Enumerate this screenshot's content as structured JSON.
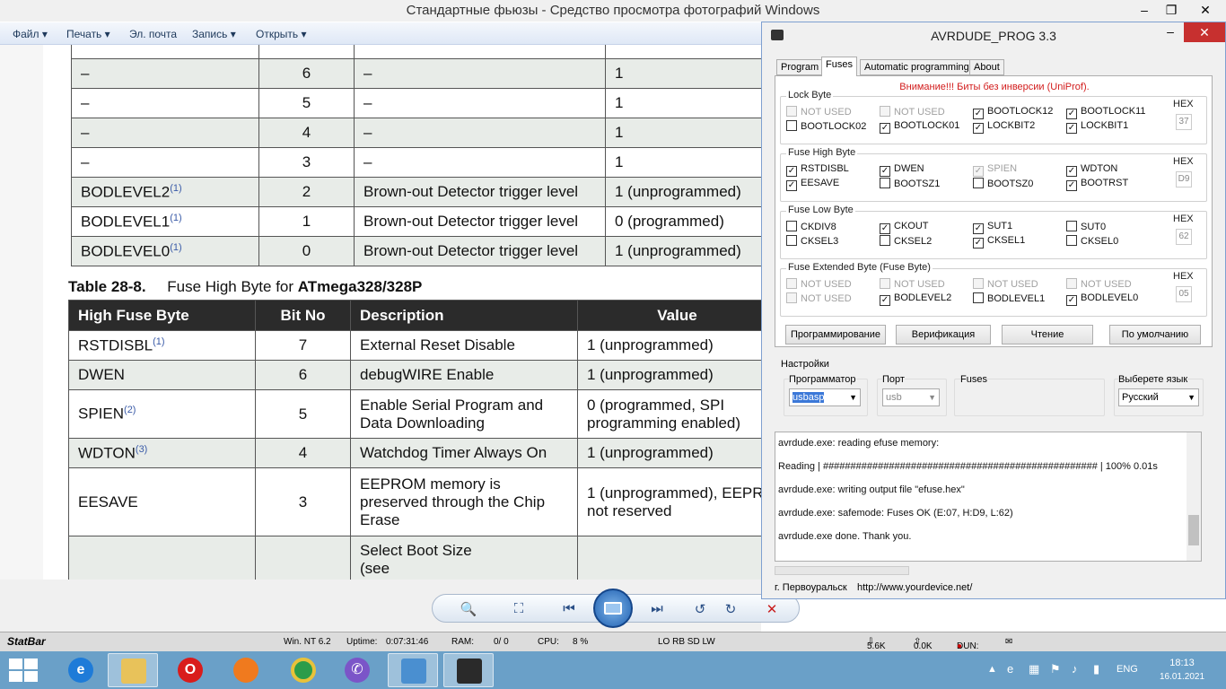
{
  "viewer": {
    "title": "Стандартные фьюзы - Средство просмотра фотографий Windows",
    "menu": [
      "Файл",
      "Печать",
      "Эл. почта",
      "Запись",
      "Открыть"
    ]
  },
  "doc": {
    "top_rows": [
      {
        "name": "–",
        "bit": "6",
        "desc": "–",
        "val": "1"
      },
      {
        "name": "–",
        "bit": "5",
        "desc": "–",
        "val": "1"
      },
      {
        "name": "–",
        "bit": "4",
        "desc": "–",
        "val": "1"
      },
      {
        "name": "–",
        "bit": "3",
        "desc": "–",
        "val": "1"
      },
      {
        "name": "BODLEVEL2",
        "sup": "(1)",
        "bit": "2",
        "desc": "Brown-out Detector trigger level",
        "val": "1 (unprogrammed)"
      },
      {
        "name": "BODLEVEL1",
        "sup": "(1)",
        "bit": "1",
        "desc": "Brown-out Detector trigger level",
        "val": "0 (programmed)"
      },
      {
        "name": "BODLEVEL0",
        "sup": "(1)",
        "bit": "0",
        "desc": "Brown-out Detector trigger level",
        "val": "1 (unprogrammed)"
      }
    ],
    "caption_num": "Table 28-8.",
    "caption_text": "Fuse High Byte for ",
    "caption_bold": "ATmega328/328P",
    "head": [
      "High Fuse Byte",
      "Bit No",
      "Description",
      "Value"
    ],
    "rows": [
      {
        "name": "RSTDISBL",
        "sup": "(1)",
        "bit": "7",
        "desc": "External Reset Disable",
        "val": "1 (unprogrammed)"
      },
      {
        "name": "DWEN",
        "sup": "",
        "bit": "6",
        "desc": "debugWIRE Enable",
        "val": "1 (unprogrammed)"
      },
      {
        "name": "SPIEN",
        "sup": "(2)",
        "bit": "5",
        "desc1": "Enable Serial Program and",
        "desc2": "Data Downloading",
        "val1": "0 (programmed, SPI",
        "val2": "programming enabled)"
      },
      {
        "name": "WDTON",
        "sup": "(3)",
        "bit": "4",
        "desc": "Watchdog Timer Always On",
        "val": "1 (unprogrammed)"
      },
      {
        "name": "EESAVE",
        "sup": "",
        "bit": "3",
        "desc1": "EEPROM memory is",
        "desc2": "preserved through the Chip",
        "desc3": "Erase",
        "val1": "1 (unprogrammed), EEPR",
        "val2": "not reserved"
      },
      {
        "desc1": "Select Boot Size",
        "desc2": "(see"
      }
    ]
  },
  "avr": {
    "title": "AVRDUDE_PROG 3.3",
    "tabs": [
      "Program",
      "Fuses",
      "Automatic programming",
      "About"
    ],
    "warning": "Внимание!!! Биты без инверсии (UniProf).",
    "lock": {
      "label": "Lock Byte",
      "hex": "37",
      "bits": [
        {
          "t": "NOT USED",
          "c": false,
          "d": true
        },
        {
          "t": "NOT USED",
          "c": false,
          "d": true
        },
        {
          "t": "BOOTLOCK12",
          "c": true,
          "d": false
        },
        {
          "t": "BOOTLOCK11",
          "c": true,
          "d": false
        },
        {
          "t": "BOOTLOCK02",
          "c": false,
          "d": false
        },
        {
          "t": "BOOTLOCK01",
          "c": true,
          "d": false
        },
        {
          "t": "LOCKBIT2",
          "c": true,
          "d": false
        },
        {
          "t": "LOCKBIT1",
          "c": true,
          "d": false
        }
      ]
    },
    "high": {
      "label": "Fuse High Byte",
      "hex": "D9",
      "bits": [
        {
          "t": "RSTDISBL",
          "c": true,
          "d": false
        },
        {
          "t": "DWEN",
          "c": true,
          "d": false
        },
        {
          "t": "SPIEN",
          "c": true,
          "d": true
        },
        {
          "t": "WDTON",
          "c": true,
          "d": false
        },
        {
          "t": "EESAVE",
          "c": true,
          "d": false
        },
        {
          "t": "BOOTSZ1",
          "c": false,
          "d": false
        },
        {
          "t": "BOOTSZ0",
          "c": false,
          "d": false
        },
        {
          "t": "BOOTRST",
          "c": true,
          "d": false
        }
      ]
    },
    "low": {
      "label": "Fuse Low Byte",
      "hex": "62",
      "bits": [
        {
          "t": "CKDIV8",
          "c": false,
          "d": false
        },
        {
          "t": "CKOUT",
          "c": true,
          "d": false
        },
        {
          "t": "SUT1",
          "c": true,
          "d": false
        },
        {
          "t": "SUT0",
          "c": false,
          "d": false
        },
        {
          "t": "CKSEL3",
          "c": false,
          "d": false
        },
        {
          "t": "CKSEL2",
          "c": false,
          "d": false
        },
        {
          "t": "CKSEL1",
          "c": true,
          "d": false
        },
        {
          "t": "CKSEL0",
          "c": false,
          "d": false
        }
      ]
    },
    "ext": {
      "label": "Fuse Extended Byte (Fuse Byte)",
      "hex": "05",
      "bits": [
        {
          "t": "NOT USED",
          "c": false,
          "d": true
        },
        {
          "t": "NOT USED",
          "c": false,
          "d": true
        },
        {
          "t": "NOT USED",
          "c": false,
          "d": true
        },
        {
          "t": "NOT USED",
          "c": false,
          "d": true
        },
        {
          "t": "NOT USED",
          "c": false,
          "d": true
        },
        {
          "t": "BODLEVEL2",
          "c": true,
          "d": false
        },
        {
          "t": "BODLEVEL1",
          "c": false,
          "d": false
        },
        {
          "t": "BODLEVEL0",
          "c": true,
          "d": false
        }
      ]
    },
    "hex_label": "HEX",
    "buttons": [
      "Программирование",
      "Верификация",
      "Чтение",
      "По умолчанию"
    ],
    "settings": {
      "label": "Настройки",
      "programmer_label": "Программатор",
      "programmer": "usbasp",
      "port_label": "Порт",
      "port": "usb",
      "fuses_label": "Fuses",
      "lang_label": "Выберете язык",
      "lang": "Русский"
    },
    "log": [
      "avrdude.exe: reading efuse memory:",
      "Reading | ################################################## | 100% 0.01s",
      "avrdude.exe: writing output file \"efuse.hex\"",
      "avrdude.exe: safemode: Fuses OK (E:07, H:D9, L:62)",
      "avrdude.exe done.  Thank you."
    ],
    "status_city": "г. Первоуральск",
    "status_url": "http://www.yourdevice.net/"
  },
  "statbar": {
    "name": "StatBar",
    "os": "Win. NT 6.2",
    "uptime_label": "Uptime:",
    "uptime": "0:07:31:46",
    "ram_label": "RAM:",
    "ram": "0/   0",
    "cpu_label": "CPU:",
    "cpu": "8 %",
    "flags": "LO RB SD LW",
    "down": "5.6K",
    "up": "0.0K",
    "dun": "DUN:"
  },
  "taskbar": {
    "lang": "ENG",
    "time": "18:13",
    "date": "16.01.2021"
  }
}
